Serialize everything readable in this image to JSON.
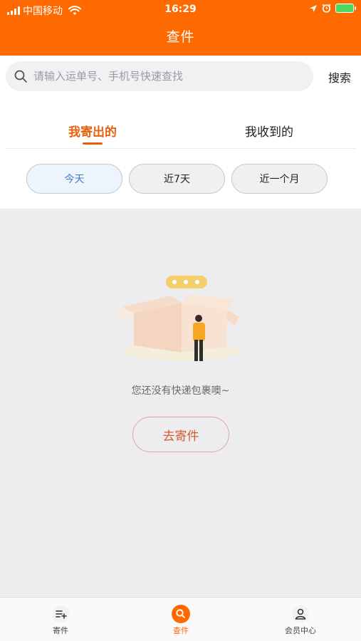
{
  "status_bar": {
    "carrier": "中国移动",
    "time": "16:29"
  },
  "header": {
    "title": "查件"
  },
  "search": {
    "placeholder": "请输入运单号、手机号快速查找",
    "button_label": "搜索"
  },
  "tabs": [
    {
      "label": "我寄出的",
      "active": true
    },
    {
      "label": "我收到的",
      "active": false
    }
  ],
  "filters": [
    {
      "label": "今天",
      "active": true
    },
    {
      "label": "近7天",
      "active": false
    },
    {
      "label": "近一个月",
      "active": false
    }
  ],
  "empty_state": {
    "message": "您还没有快递包裹噢~",
    "action_label": "去寄件"
  },
  "tab_bar": [
    {
      "label": "寄件",
      "icon": "send-package-icon",
      "active": false
    },
    {
      "label": "查件",
      "icon": "search-icon",
      "active": true
    },
    {
      "label": "会员中心",
      "icon": "user-icon",
      "active": false
    }
  ],
  "colors": {
    "brand": "#ff6a00",
    "active_tab": "#e8600b",
    "active_chip_text": "#3e7ccf"
  }
}
